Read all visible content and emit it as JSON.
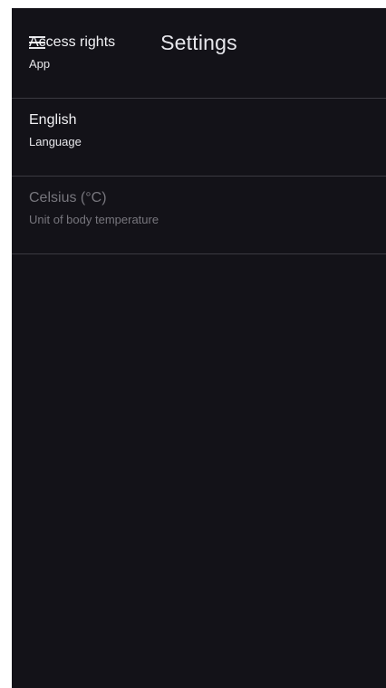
{
  "header": {
    "title": "Settings",
    "menu_icon": "hamburger-menu-icon"
  },
  "settings": {
    "items": [
      {
        "title": "Access rights",
        "subtitle": "App",
        "enabled": true
      },
      {
        "title": "English",
        "subtitle": "Language",
        "enabled": true
      },
      {
        "title": "Celsius (°C)",
        "subtitle": "Unit of body temperature",
        "enabled": false
      }
    ]
  },
  "colors": {
    "background": "#131218",
    "divider": "#3b3a41",
    "text_primary": "#f1f1f4",
    "text_disabled": "#77767d"
  }
}
